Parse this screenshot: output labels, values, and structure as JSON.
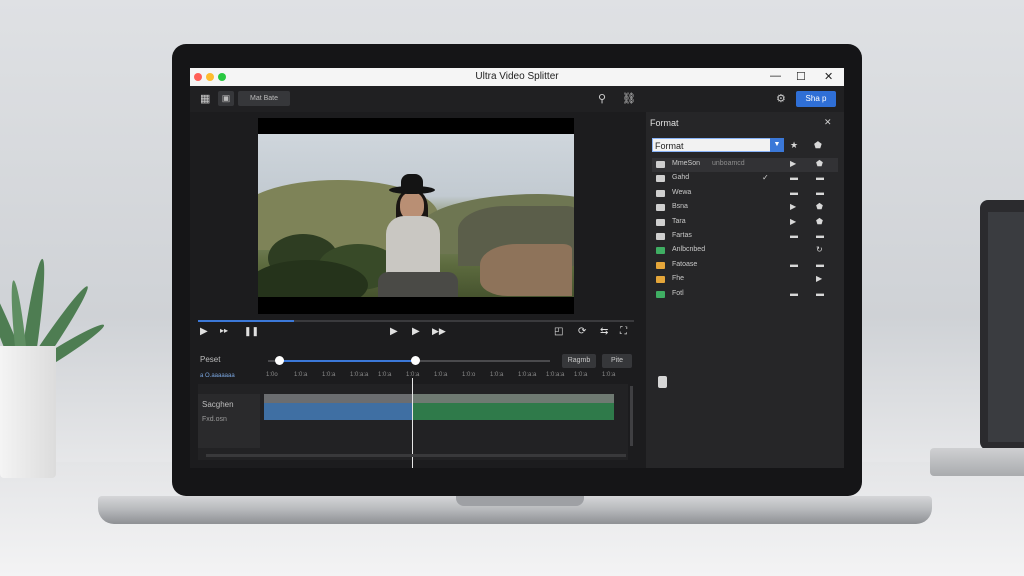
{
  "window": {
    "title": "Ultra Video Splitter",
    "minimize": "—",
    "maximize": "☐",
    "close": "✕"
  },
  "toolbar": {
    "media_button": "Mat Bate",
    "share_button": "Sha p"
  },
  "player": {
    "progress_fraction": 0.22
  },
  "timeline": {
    "preset_label": "Peset",
    "apply_button": "Ragmb",
    "side_button": "Pite",
    "zoom_label": "a O.aaaaaaa",
    "ruler_ticks": [
      "1:0o",
      "1:0:a",
      "1:0:a",
      "1:0:a:a",
      "1:0:a",
      "1:0:a",
      "1:0:a",
      "1:0:o",
      "1:0:a",
      "1:0:a:a",
      "1:0:a:a",
      "1:0:a",
      "1:0:a"
    ],
    "track_name": "Sacghen",
    "track_sub": "Fxd.osn",
    "zoom_range": [
      0.04,
      0.52
    ]
  },
  "format_panel": {
    "title": "Format",
    "close": "✕",
    "select_value": "Format",
    "rows": [
      {
        "label": "MmeSon",
        "tag": "unboamcd",
        "icon_color": "#cfcfcf",
        "check": "",
        "a": "▶",
        "b": "⬟"
      },
      {
        "label": "Gahd",
        "tag": "",
        "icon_color": "#cfcfcf",
        "check": "✓",
        "a": "▬",
        "b": "▬"
      },
      {
        "label": "Wewa",
        "tag": "",
        "icon_color": "#cfcfcf",
        "check": "",
        "a": "▬",
        "b": "▬"
      },
      {
        "label": "Bsna",
        "tag": "",
        "icon_color": "#cfcfcf",
        "check": "",
        "a": "▶",
        "b": "⬟"
      },
      {
        "label": "Tara",
        "tag": "",
        "icon_color": "#cfcfcf",
        "check": "",
        "a": "▶",
        "b": "⬟"
      },
      {
        "label": "Fartas",
        "tag": "",
        "icon_color": "#cfcfcf",
        "check": "",
        "a": "▬",
        "b": "▬"
      },
      {
        "label": "Anlbcnbed",
        "tag": "",
        "icon_color": "#3fae63",
        "check": "",
        "a": "",
        "b": "↻"
      },
      {
        "label": "Fatoase",
        "tag": "",
        "icon_color": "#e5a63a",
        "check": "",
        "a": "▬",
        "b": "▬"
      },
      {
        "label": "Fhe",
        "tag": "",
        "icon_color": "#e5a63a",
        "check": "",
        "a": "",
        "b": "▶"
      },
      {
        "label": "Fotl",
        "tag": "",
        "icon_color": "#3fae63",
        "check": "",
        "a": "▬",
        "b": "▬"
      }
    ]
  },
  "colors": {
    "accent": "#2f6fd6",
    "clip_a": "#3f6fa3",
    "clip_b": "#2f7a4a"
  }
}
